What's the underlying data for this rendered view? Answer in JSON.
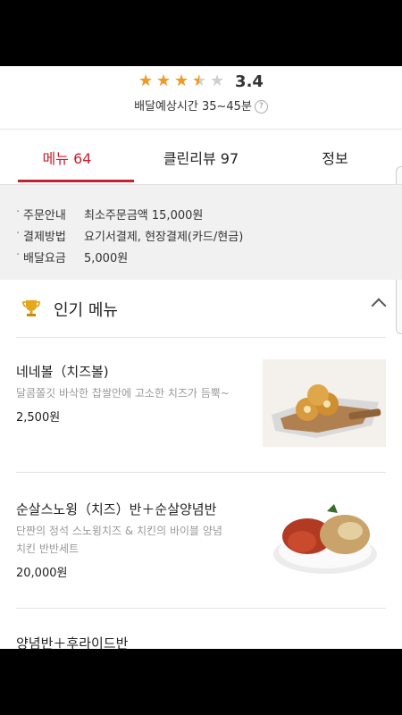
{
  "store": {
    "rating": 3.4,
    "rating_text": "3.4",
    "delivery_time": "배달예상시간 35~45분",
    "help_icon": "?"
  },
  "tabs": [
    {
      "label": "메뉴 64",
      "active": true
    },
    {
      "label": "클린리뷰 97",
      "active": false
    },
    {
      "label": "정보",
      "active": false
    }
  ],
  "info": [
    {
      "label": "주문안내",
      "value": "최소주문금액 15,000원"
    },
    {
      "label": "결제방법",
      "value": "요기서결제, 현장결제(카드/현금)"
    },
    {
      "label": "배달요금",
      "value": "5,000원"
    }
  ],
  "popular": {
    "title": "인기 메뉴",
    "icon": "trophy-icon"
  },
  "menu": [
    {
      "name": "네네볼（치즈볼)",
      "desc": "달콤쫄깃 바삭한 찹쌀안에 고소한 치즈가 듬뿍~",
      "price": "2,500원"
    },
    {
      "name": "순살스노윙（치즈）반＋순살양념반",
      "desc": "단짠의 정석 스노윙치즈 & 치킨의 바이블 양념치킨 반반세트",
      "price": "20,000원"
    },
    {
      "name": "양념반＋후라이드반",
      "desc": "",
      "price": ""
    }
  ],
  "colors": {
    "accent": "#c7202f",
    "star": "#f29a1d",
    "info_bg": "#f1f1f1"
  }
}
